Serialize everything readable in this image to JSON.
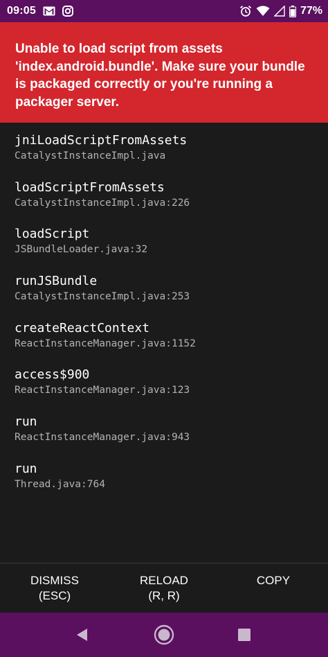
{
  "status_bar": {
    "time": "09:05",
    "battery_percent": "77%"
  },
  "error": {
    "message": "Unable to load script from assets 'index.android.bundle'. Make sure your bundle is packaged correctly or you're running a packager server."
  },
  "stack": [
    {
      "method": "jniLoadScriptFromAssets",
      "file": "CatalystInstanceImpl.java"
    },
    {
      "method": "loadScriptFromAssets",
      "file": "CatalystInstanceImpl.java:226"
    },
    {
      "method": "loadScript",
      "file": "JSBundleLoader.java:32"
    },
    {
      "method": "runJSBundle",
      "file": "CatalystInstanceImpl.java:253"
    },
    {
      "method": "createReactContext",
      "file": "ReactInstanceManager.java:1152"
    },
    {
      "method": "access$900",
      "file": "ReactInstanceManager.java:123"
    },
    {
      "method": "run",
      "file": "ReactInstanceManager.java:943"
    },
    {
      "method": "run",
      "file": "Thread.java:764"
    }
  ],
  "actions": {
    "dismiss": {
      "line1": "DISMISS",
      "line2": "(ESC)"
    },
    "reload": {
      "line1": "RELOAD",
      "line2": "(R, R)"
    },
    "copy": {
      "line1": "COPY"
    }
  },
  "icons": {
    "gmail": "gmail-icon",
    "instagram": "instagram-icon",
    "alarm": "alarm-icon",
    "wifi": "wifi-icon",
    "signal": "signal-icon",
    "battery": "battery-icon",
    "back": "back-icon",
    "home": "home-icon",
    "recents": "recents-icon"
  },
  "colors": {
    "status_bar": "#5a0f5f",
    "error_red": "#d3262d",
    "background": "#1b1b1b"
  }
}
